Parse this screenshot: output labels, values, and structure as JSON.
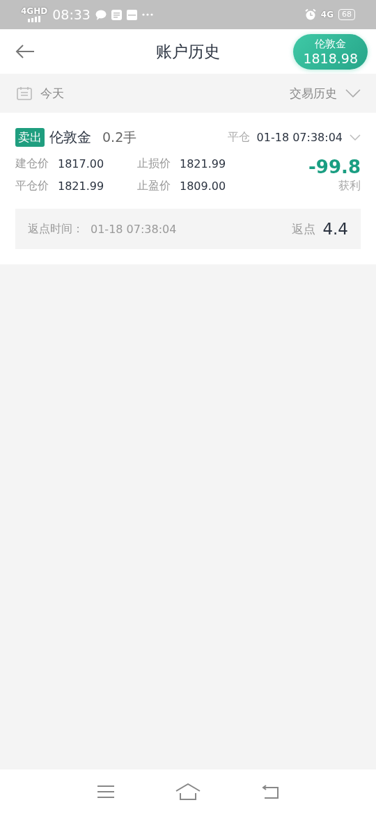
{
  "status_bar": {
    "network_label": "4GHD",
    "time": "08:33",
    "mobile_label": "4G",
    "battery": "68"
  },
  "header": {
    "title": "账户历史",
    "quote": {
      "name": "伦敦金",
      "price": "1818.98"
    }
  },
  "filter": {
    "date": "今天",
    "type": "交易历史"
  },
  "trades": [
    {
      "side": "卖出",
      "color": "#1f9e7f",
      "symbol": "伦敦金",
      "lots": "0.2手",
      "status": "平仓",
      "time": "01-18 07:38:04",
      "expanded": false,
      "fields": [
        {
          "label": "建仓价",
          "value": "1817.00"
        },
        {
          "label": "止损价",
          "value": "1821.99"
        },
        {
          "label": "平仓价",
          "value": "1821.99"
        },
        {
          "label": "止盈价",
          "value": "1809.00"
        }
      ],
      "profit": "-99.8",
      "profit_label": "获利",
      "rebate_time_label": "返点时间：",
      "rebate_time": "01-18 07:38:04",
      "rebate_label": "返点",
      "rebate": "4.4"
    }
  ]
}
